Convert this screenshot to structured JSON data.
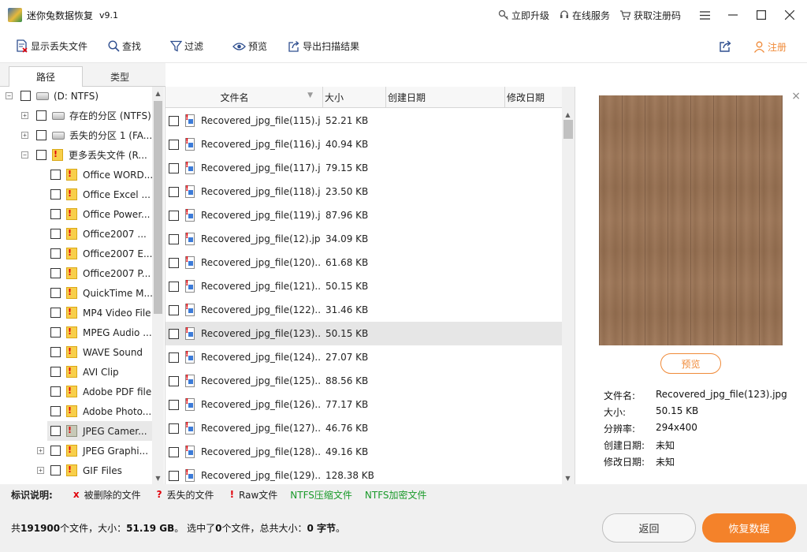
{
  "window": {
    "title": "迷你兔数据恢复",
    "version": "v9.1",
    "links": {
      "upgrade": "立即升级",
      "online_service": "在线服务",
      "get_code": "获取注册码"
    }
  },
  "toolbar": {
    "show_lost": "显示丢失文件",
    "find": "查找",
    "filter": "过滤",
    "preview": "预览",
    "export": "导出扫描结果",
    "register": "注册"
  },
  "tabs": {
    "path": "路径",
    "type": "类型"
  },
  "tree": {
    "root": "(D: NTFS)",
    "nodes": [
      "存在的分区 (NTFS)",
      "丢失的分区 1 (FA...",
      "更多丢失文件 (R..."
    ],
    "children": [
      "Office WORD...",
      "Office Excel ...",
      "Office Power...",
      "Office2007 ...",
      "Office2007 E...",
      "Office2007 P...",
      "QuickTime M...",
      "MP4 Video File",
      "MPEG Audio ...",
      "WAVE Sound",
      "AVI Clip",
      "Adobe PDF file",
      "Adobe Photo...",
      "JPEG Camer...",
      "JPEG Graphi...",
      "GIF Files"
    ]
  },
  "list": {
    "headers": {
      "name": "文件名",
      "size": "大小",
      "created": "创建日期",
      "modified": "修改日期"
    },
    "rows": [
      {
        "name": "Recovered_jpg_file(115).j...",
        "size": "52.21 KB"
      },
      {
        "name": "Recovered_jpg_file(116).j...",
        "size": "40.94 KB"
      },
      {
        "name": "Recovered_jpg_file(117).j...",
        "size": "79.15 KB"
      },
      {
        "name": "Recovered_jpg_file(118).j...",
        "size": "23.50 KB"
      },
      {
        "name": "Recovered_jpg_file(119).j...",
        "size": "87.96 KB"
      },
      {
        "name": "Recovered_jpg_file(12).jpg",
        "size": "34.09 KB"
      },
      {
        "name": "Recovered_jpg_file(120)....",
        "size": "61.68 KB"
      },
      {
        "name": "Recovered_jpg_file(121)....",
        "size": "50.15 KB"
      },
      {
        "name": "Recovered_jpg_file(122)....",
        "size": "31.46 KB"
      },
      {
        "name": "Recovered_jpg_file(123)....",
        "size": "50.15 KB"
      },
      {
        "name": "Recovered_jpg_file(124)....",
        "size": "27.07 KB"
      },
      {
        "name": "Recovered_jpg_file(125)....",
        "size": "88.56 KB"
      },
      {
        "name": "Recovered_jpg_file(126)....",
        "size": "77.17 KB"
      },
      {
        "name": "Recovered_jpg_file(127)....",
        "size": "46.76 KB"
      },
      {
        "name": "Recovered_jpg_file(128)....",
        "size": "49.16 KB"
      },
      {
        "name": "Recovered_jpg_file(129)....",
        "size": "128.38 KB"
      }
    ],
    "selected_index": 9
  },
  "preview": {
    "button": "预览",
    "labels": {
      "filename": "文件名:",
      "size": "大小:",
      "resolution": "分辨率:",
      "created": "创建日期:",
      "modified": "修改日期:"
    },
    "values": {
      "filename": "Recovered_jpg_file(123).jpg",
      "size": "50.15 KB",
      "resolution": "294x400",
      "created": "未知",
      "modified": "未知"
    }
  },
  "legend": {
    "title": "标识说明:",
    "deleted_mark": "x",
    "deleted": "被删除的文件",
    "lost_mark": "?",
    "lost": "丢失的文件",
    "raw_mark": "!",
    "raw": "Raw文件",
    "ntfs_compressed": "NTFS压缩文件",
    "ntfs_encrypted": "NTFS加密文件"
  },
  "summary": {
    "p1": "共",
    "file_count": "191900",
    "p2": "个文件，大小：",
    "total_size": "51.19 GB",
    "p3": "。 选中了",
    "selected_count": "0",
    "p4": "个文件，总共大小：",
    "selected_size": "0 字节",
    "p5": "。"
  },
  "actions": {
    "back": "返回",
    "recover": "恢复数据"
  },
  "colors": {
    "accent": "#f4822a",
    "deleted": "#e0000a",
    "ntfs": "#1a9a2a"
  }
}
